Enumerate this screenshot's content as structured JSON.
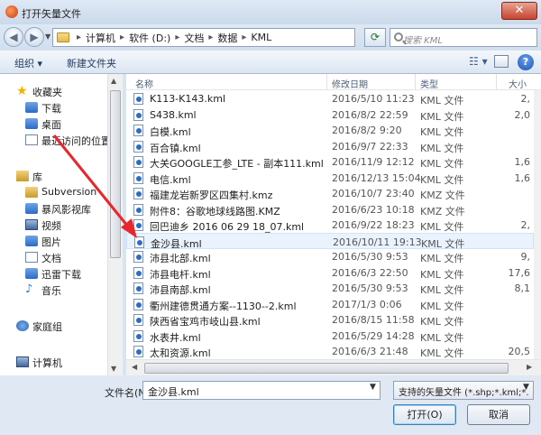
{
  "window": {
    "title": "打开矢量文件",
    "close_label": "✕"
  },
  "nav": {
    "back_label": "◀",
    "forward_label": "▶",
    "breadcrumbs": [
      "计算机",
      "软件 (D:)",
      "文档",
      "数据",
      "KML"
    ],
    "search_placeholder": "搜索 KML"
  },
  "toolbar": {
    "organize_label": "组织 ▾",
    "new_folder_label": "新建文件夹",
    "view_label": "☷ ▾",
    "help_label": "?"
  },
  "sidebar": {
    "items": [
      {
        "label": "收藏夹",
        "icon": "star-icon"
      },
      {
        "label": "下载",
        "icon": "download-folder-icon"
      },
      {
        "label": "桌面",
        "icon": "desktop-icon"
      },
      {
        "label": "最近访问的位置",
        "icon": "recent-places-icon"
      },
      {
        "label": "库",
        "icon": "library-icon"
      },
      {
        "label": "Subversion",
        "icon": "subversion-icon"
      },
      {
        "label": "暴风影视库",
        "icon": "video-library-icon"
      },
      {
        "label": "视频",
        "icon": "video-icon"
      },
      {
        "label": "图片",
        "icon": "pictures-icon"
      },
      {
        "label": "文档",
        "icon": "documents-icon"
      },
      {
        "label": "迅雷下载",
        "icon": "thunder-download-icon"
      },
      {
        "label": "音乐",
        "icon": "music-icon"
      },
      {
        "label": "家庭组",
        "icon": "homegroup-icon"
      },
      {
        "label": "计算机",
        "icon": "computer-icon"
      }
    ]
  },
  "columns": {
    "name": "名称",
    "date": "修改日期",
    "type": "类型",
    "size": "大小"
  },
  "files": [
    {
      "name": "K113-K143.kml",
      "date": "2016/5/10 11:23",
      "type": "KML 文件",
      "size": "2,"
    },
    {
      "name": "S438.kml",
      "date": "2016/8/2 22:59",
      "type": "KML 文件",
      "size": "2,0"
    },
    {
      "name": "白模.kml",
      "date": "2016/8/2 9:20",
      "type": "KML 文件",
      "size": ""
    },
    {
      "name": "百合镇.kml",
      "date": "2016/9/7 22:33",
      "type": "KML 文件",
      "size": ""
    },
    {
      "name": "大关GOOGLE工参_LTE - 副本111.kml",
      "date": "2016/11/9 12:12",
      "type": "KML 文件",
      "size": "1,6"
    },
    {
      "name": "电信.kml",
      "date": "2016/12/13 15:04",
      "type": "KML 文件",
      "size": "1,6"
    },
    {
      "name": "福建龙岩新罗区四集村.kmz",
      "date": "2016/10/7 23:40",
      "type": "KMZ 文件",
      "size": ""
    },
    {
      "name": "附件8：谷歌地球线路图.KMZ",
      "date": "2016/6/23 10:18",
      "type": "KMZ 文件",
      "size": ""
    },
    {
      "name": "回巴迪乡 2016 06 29 18_07.kml",
      "date": "2016/9/22 18:23",
      "type": "KML 文件",
      "size": "2,"
    },
    {
      "name": "金沙县.kml",
      "date": "2016/10/11 19:13",
      "type": "KML 文件",
      "size": "",
      "selected": true
    },
    {
      "name": "沛县北部.kml",
      "date": "2016/5/30 9:53",
      "type": "KML 文件",
      "size": "9,"
    },
    {
      "name": "沛县电杆.kml",
      "date": "2016/6/3 22:50",
      "type": "KML 文件",
      "size": "17,6"
    },
    {
      "name": "沛县南部.kml",
      "date": "2016/5/30 9:53",
      "type": "KML 文件",
      "size": "8,1"
    },
    {
      "name": "衢州建德贯通方案--1130--2.kml",
      "date": "2017/1/3 0:06",
      "type": "KML 文件",
      "size": ""
    },
    {
      "name": "陕西省宝鸡市岐山县.kml",
      "date": "2016/8/15 11:58",
      "type": "KML 文件",
      "size": ""
    },
    {
      "name": "水表井.kml",
      "date": "2016/5/29 14:28",
      "type": "KML 文件",
      "size": ""
    },
    {
      "name": "太和资源.kml",
      "date": "2016/6/3 21:48",
      "type": "KML 文件",
      "size": "20,5"
    }
  ],
  "footer": {
    "filename_label": "文件名(N):",
    "filename_value": "金沙县.kml",
    "filetype_value": "支持的矢量文件 (*.shp;*.kml;*.",
    "open_label": "打开(O)",
    "cancel_label": "取消"
  }
}
